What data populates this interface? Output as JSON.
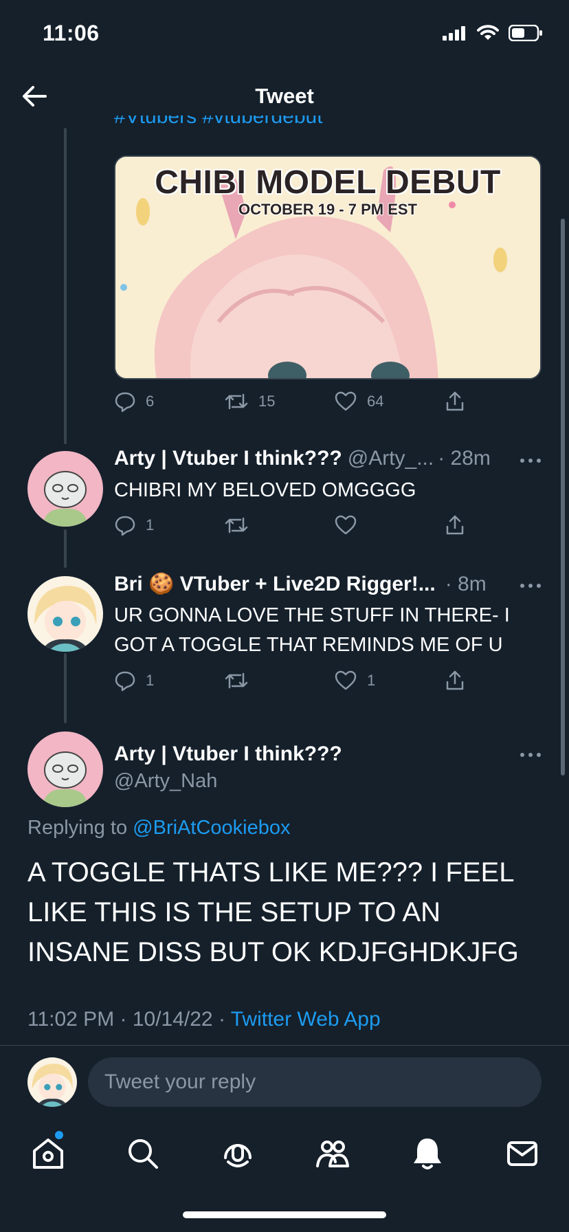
{
  "status_bar": {
    "time": "11:06"
  },
  "header": {
    "title": "Tweet"
  },
  "parent_tweet": {
    "hashtags": "#Vtubers #vtuberdebut",
    "media_title": "CHIBI MODEL DEBUT",
    "media_subtitle": "OCTOBER 19 - 7 PM EST",
    "replies": "6",
    "retweets": "15",
    "likes": "64"
  },
  "replies": [
    {
      "name": "Arty | Vtuber I think???",
      "handle": "@Arty_...",
      "time": "· 28m",
      "text": "CHIBRI MY BELOVED OMGGGG",
      "replies": "1",
      "retweets": "",
      "likes": ""
    },
    {
      "name": "Bri 🍪 VTuber + Live2D Rigger!...",
      "handle": "",
      "time": "· 8m",
      "text": "UR GONNA LOVE THE STUFF IN THERE- I GOT A TOGGLE THAT REMINDS ME OF U",
      "replies": "1",
      "retweets": "",
      "likes": "1"
    }
  ],
  "main_tweet": {
    "name": "Arty | Vtuber I think???",
    "handle": "@Arty_Nah",
    "replying_prefix": "Replying to ",
    "replying_to": "@BriAtCookiebox",
    "text": "A TOGGLE THATS LIKE ME??? I FEEL LIKE THIS IS THE SETUP TO AN INSANE DISS BUT OK KDJFGHDKJFG",
    "timestamp": "11:02 PM · 10/14/22 · ",
    "source": "Twitter Web App"
  },
  "compose": {
    "placeholder": "Tweet your reply"
  },
  "colors": {
    "background": "#15202b",
    "accent": "#1d9bf0",
    "muted": "#8b98a5",
    "divider": "#38444d"
  },
  "icons": [
    "back-arrow-icon",
    "signal-icon",
    "wifi-icon",
    "battery-icon",
    "reply-icon",
    "retweet-icon",
    "like-icon",
    "share-icon",
    "more-icon",
    "home-icon",
    "search-icon",
    "spaces-icon",
    "communities-icon",
    "notifications-icon",
    "messages-icon"
  ]
}
